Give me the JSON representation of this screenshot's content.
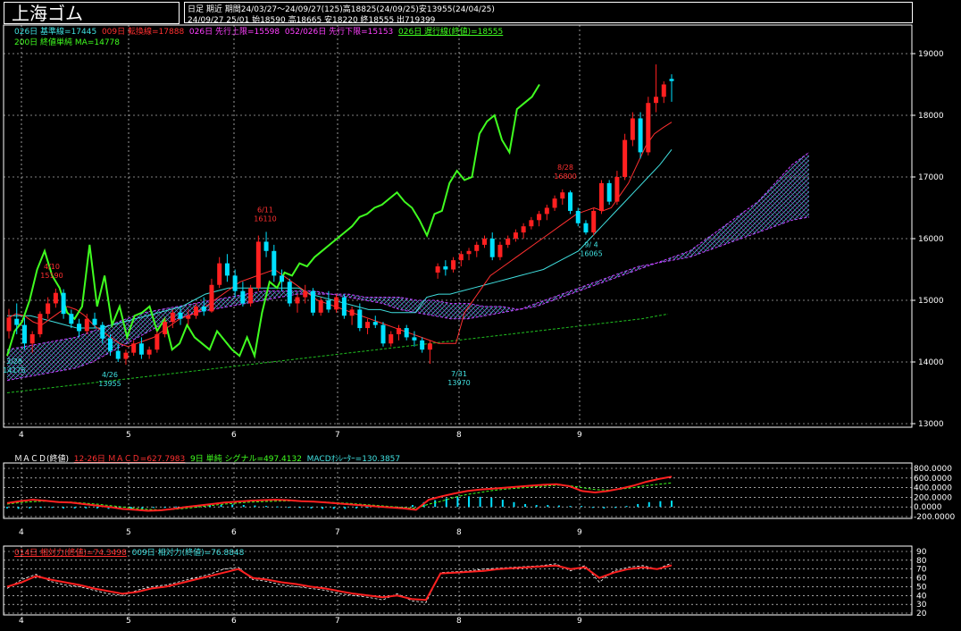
{
  "header": {
    "title": "上海ゴム",
    "period_line1": "日足  期近  期間24/03/27～24/09/27(125)高18825(24/09/25)安13955(24/04/25)",
    "period_line2": "24/09/27 25/01 始18590 高18665 安18220 終18555 出719399"
  },
  "legend": {
    "kijun": "026日 基準線=17445",
    "tenkan": "009日 転換線=17888",
    "senkou1": "026日 先行上限=15598",
    "senkou2": "052/026日 先行下限=15153",
    "chikou": "026日 遅行線(終値)=18555",
    "ma200": "200日 終値単純 MA=14778"
  },
  "macd_legend": {
    "name": "ＭＡＣＤ(終値)",
    "macd": "12-26日 ＭＡＣＤ=627.7983",
    "signal": "9日 単純 シグナル=497.4132",
    "osc": "MACDｵｼﾚｰﾀｰ=130.3857"
  },
  "rsi_legend": {
    "rsi14": "014日 相対力(終値)=74.3498",
    "rsi9": "009日 相対力(終値)=76.8848"
  },
  "colors": {
    "bg": "#000000",
    "up": "#ff2020",
    "down": "#00e0ff",
    "chikou": "#40ff20",
    "ma": "#20c020",
    "kijun": "#40e0e0",
    "tenkan": "#ff3030",
    "cloud": "#c040ff",
    "grid": "#ffffff"
  },
  "chart_data": [
    {
      "type": "candlestick",
      "ylim": [
        13000,
        19200
      ],
      "yticks": [
        "19000",
        "18000",
        "17000",
        "16000",
        "15000",
        "14000",
        "13000"
      ],
      "xtick_labels": [
        "4",
        "5",
        "6",
        "7",
        "8",
        "9"
      ],
      "annotations": [
        {
          "label": "4/10",
          "value": "15190"
        },
        {
          "label": "3/28",
          "value": "14175"
        },
        {
          "label": "4/26",
          "value": "13955"
        },
        {
          "label": "6/11",
          "value": "16110"
        },
        {
          "label": "7/31",
          "value": "13970"
        },
        {
          "label": "8/28",
          "value": "16800"
        },
        {
          "label": "9/ 4",
          "value": "16065"
        }
      ],
      "ohlc": [
        [
          14500,
          14860,
          14380,
          14720
        ],
        [
          14700,
          14950,
          14450,
          14600
        ],
        [
          14600,
          14720,
          14200,
          14300
        ],
        [
          14300,
          14500,
          14150,
          14450
        ],
        [
          14450,
          14820,
          14400,
          14780
        ],
        [
          14780,
          15050,
          14700,
          14950
        ],
        [
          14950,
          15190,
          14880,
          15120
        ],
        [
          15120,
          15180,
          14700,
          14780
        ],
        [
          14780,
          14850,
          14550,
          14620
        ],
        [
          14620,
          14700,
          14400,
          14500
        ],
        [
          14500,
          14780,
          14450,
          14700
        ],
        [
          14700,
          14800,
          14550,
          14600
        ],
        [
          14600,
          14650,
          14300,
          14380
        ],
        [
          14380,
          14450,
          14100,
          14180
        ],
        [
          14180,
          14300,
          14000,
          14050
        ],
        [
          14050,
          14200,
          13955,
          14150
        ],
        [
          14150,
          14350,
          14100,
          14300
        ],
        [
          14300,
          14400,
          14050,
          14120
        ],
        [
          14120,
          14250,
          14050,
          14200
        ],
        [
          14200,
          14500,
          14150,
          14450
        ],
        [
          14450,
          14700,
          14400,
          14650
        ],
        [
          14650,
          14850,
          14550,
          14800
        ],
        [
          14800,
          14900,
          14600,
          14700
        ],
        [
          14700,
          14850,
          14600,
          14750
        ],
        [
          14750,
          14950,
          14700,
          14900
        ],
        [
          14900,
          15050,
          14750,
          14820
        ],
        [
          14820,
          15350,
          14800,
          15250
        ],
        [
          15250,
          15700,
          15200,
          15600
        ],
        [
          15600,
          15750,
          15300,
          15400
        ],
        [
          15400,
          15500,
          15050,
          15150
        ],
        [
          15150,
          15300,
          14900,
          14950
        ],
        [
          14950,
          15250,
          14900,
          15200
        ],
        [
          15200,
          16050,
          15150,
          15950
        ],
        [
          15950,
          16110,
          15700,
          15800
        ],
        [
          15800,
          15900,
          15300,
          15400
        ],
        [
          15400,
          15500,
          15150,
          15300
        ],
        [
          15300,
          15350,
          14900,
          14950
        ],
        [
          14950,
          15100,
          14800,
          15050
        ],
        [
          15050,
          15250,
          14950,
          15150
        ],
        [
          15150,
          15200,
          14750,
          14800
        ],
        [
          14800,
          15050,
          14750,
          15000
        ],
        [
          15000,
          15150,
          14800,
          14850
        ],
        [
          14850,
          15100,
          14800,
          15050
        ],
        [
          15050,
          15100,
          14700,
          14750
        ],
        [
          14750,
          14900,
          14600,
          14850
        ],
        [
          14850,
          14950,
          14500,
          14550
        ],
        [
          14550,
          14700,
          14450,
          14650
        ],
        [
          14650,
          14750,
          14550,
          14600
        ],
        [
          14600,
          14650,
          14250,
          14300
        ],
        [
          14300,
          14500,
          14250,
          14450
        ],
        [
          14450,
          14600,
          14350,
          14550
        ],
        [
          14550,
          14600,
          14350,
          14400
        ],
        [
          14400,
          14500,
          14250,
          14350
        ],
        [
          14350,
          14400,
          14150,
          14200
        ],
        [
          14200,
          14350,
          13970,
          14300
        ],
        [
          15450,
          15600,
          15350,
          15550
        ],
        [
          15550,
          15650,
          15400,
          15500
        ],
        [
          15500,
          15700,
          15450,
          15650
        ],
        [
          15650,
          15800,
          15550,
          15750
        ],
        [
          15750,
          15850,
          15650,
          15800
        ],
        [
          15800,
          15950,
          15700,
          15900
        ],
        [
          15900,
          16050,
          15850,
          16000
        ],
        [
          16000,
          16100,
          15650,
          15700
        ],
        [
          15700,
          15950,
          15650,
          15900
        ],
        [
          15900,
          16050,
          15850,
          16000
        ],
        [
          16000,
          16150,
          15950,
          16100
        ],
        [
          16100,
          16250,
          16000,
          16200
        ],
        [
          16200,
          16350,
          16150,
          16300
        ],
        [
          16300,
          16450,
          16200,
          16400
        ],
        [
          16400,
          16550,
          16300,
          16500
        ],
        [
          16500,
          16700,
          16450,
          16650
        ],
        [
          16650,
          16800,
          16550,
          16750
        ],
        [
          16750,
          16780,
          16400,
          16450
        ],
        [
          16450,
          16500,
          16200,
          16250
        ],
        [
          16250,
          16300,
          16065,
          16100
        ],
        [
          16100,
          16500,
          16050,
          16450
        ],
        [
          16450,
          16950,
          16400,
          16900
        ],
        [
          16900,
          16950,
          16550,
          16600
        ],
        [
          16600,
          17100,
          16550,
          17000
        ],
        [
          17000,
          17700,
          16950,
          17600
        ],
        [
          17600,
          18050,
          17500,
          17950
        ],
        [
          17950,
          18050,
          17300,
          17400
        ],
        [
          17400,
          18300,
          17350,
          18200
        ],
        [
          18200,
          18825,
          18050,
          18300
        ],
        [
          18300,
          18550,
          18200,
          18500
        ],
        [
          18590,
          18665,
          18220,
          18555
        ]
      ],
      "chikou_span": [
        14100,
        14500,
        14650,
        15000,
        15500,
        15800,
        15400,
        15200,
        14800,
        14700,
        14900,
        15900,
        14900,
        15400,
        14600,
        14900,
        14400,
        14750,
        14800,
        14900,
        14500,
        14700,
        14200,
        14300,
        14600,
        14400,
        14300,
        14200,
        14500,
        14350,
        14200,
        14100,
        14400,
        14100,
        14800,
        15300,
        15200,
        15450,
        15400,
        15600,
        15550,
        15700,
        15800,
        15900,
        16000,
        16100,
        16200,
        16350,
        16400,
        16500,
        16550,
        16650,
        16750,
        16600,
        16500,
        16300,
        16050,
        16400,
        16450,
        16900,
        17100,
        16950,
        17000,
        17700,
        17900,
        18000,
        17600,
        17400,
        18100,
        18200,
        18300,
        18500
      ],
      "tenkan_sen": [
        14700,
        14780,
        14750,
        14650,
        14600,
        14700,
        14800,
        14900,
        14850,
        14750,
        14600,
        14500,
        14400,
        14300,
        14250,
        14300,
        14350,
        14400,
        14500,
        14600,
        14700,
        14750,
        14800,
        14900,
        15000,
        15100,
        15200,
        15300,
        15350,
        15400,
        15450,
        15500,
        15400,
        15300,
        15200,
        15100,
        15000,
        14950,
        14900,
        14850,
        14800,
        14750,
        14700,
        14650,
        14600,
        14550,
        14500,
        14450,
        14400,
        14350,
        14300,
        14300,
        14300,
        14800,
        15000,
        15200,
        15400,
        15500,
        15600,
        15700,
        15800,
        15900,
        16000,
        16100,
        16200,
        16300,
        16400,
        16450,
        16500,
        16450,
        16500,
        16700,
        16900,
        17200,
        17500,
        17700,
        17800,
        17888
      ],
      "kijun_sen": [
        14750,
        14750,
        14750,
        14700,
        14650,
        14600,
        14550,
        14550,
        14550,
        14600,
        14650,
        14700,
        14750,
        14800,
        14850,
        14900,
        15000,
        15100,
        15150,
        15200,
        15200,
        15200,
        15200,
        15200,
        15200,
        15200,
        15100,
        15050,
        15000,
        14950,
        14900,
        14850,
        14850,
        14800,
        14800,
        14800,
        15050,
        15100,
        15100,
        15150,
        15200,
        15250,
        15300,
        15350,
        15400,
        15450,
        15500,
        15600,
        15700,
        15800,
        16000,
        16200,
        16400,
        16600,
        16800,
        17000,
        17200,
        17445
      ],
      "cloud_upper": [
        14200,
        14250,
        14300,
        14350,
        14400,
        14500,
        14600,
        14700,
        14800,
        14850,
        14900,
        14950,
        15000,
        15050,
        15100,
        15150,
        15150,
        15150,
        15150,
        15100,
        15100,
        15050,
        15050,
        15050,
        15000,
        15000,
        14950,
        14950,
        14900,
        14900,
        14850,
        14900,
        15000,
        15100,
        15200,
        15300,
        15400,
        15500,
        15600,
        15700,
        15800,
        16000,
        16200,
        16400,
        16600,
        16900,
        17200,
        17400
      ],
      "cloud_lower": [
        13700,
        13750,
        13800,
        13850,
        13900,
        14000,
        14150,
        14300,
        14450,
        14600,
        14700,
        14800,
        14850,
        14900,
        14950,
        15000,
        15050,
        15100,
        15100,
        15100,
        15050,
        15000,
        14950,
        14850,
        14800,
        14750,
        14700,
        14700,
        14750,
        14800,
        14850,
        14950,
        15050,
        15150,
        15250,
        15350,
        15450,
        15550,
        15600,
        15650,
        15700,
        15800,
        15900,
        16000,
        16100,
        16200,
        16300,
        16350
      ],
      "ma200": [
        13500,
        13550,
        13600,
        13650,
        13700,
        13750,
        13800,
        13850,
        13900,
        13950,
        14000,
        14050,
        14100,
        14150,
        14200,
        14250,
        14300,
        14350,
        14400,
        14450,
        14500,
        14550,
        14600,
        14650,
        14700,
        14778
      ]
    },
    {
      "type": "line",
      "title": "ＭＡＣＤ(終値)",
      "ylim": [
        -200,
        800
      ],
      "yticks": [
        "800.0000",
        "600.0000",
        "400.0000",
        "200.0000",
        "0.0000",
        "-200.0000"
      ],
      "series": [
        {
          "name": "12-26日 ＭＡＣＤ",
          "values": [
            80,
            120,
            150,
            130,
            100,
            90,
            60,
            30,
            0,
            -40,
            -60,
            -80,
            -70,
            -40,
            0,
            30,
            60,
            90,
            110,
            130,
            140,
            150,
            140,
            120,
            110,
            90,
            70,
            50,
            30,
            10,
            -10,
            -30,
            -60,
            150,
            220,
            280,
            330,
            360,
            380,
            400,
            420,
            440,
            460,
            470,
            430,
            330,
            300,
            330,
            380,
            440,
            520,
            580,
            627.8
          ]
        },
        {
          "name": "9日 単純 シグナル",
          "values": [
            60,
            90,
            110,
            120,
            110,
            100,
            80,
            60,
            30,
            0,
            -30,
            -50,
            -60,
            -50,
            -30,
            0,
            30,
            60,
            80,
            100,
            110,
            120,
            125,
            120,
            110,
            100,
            85,
            70,
            50,
            30,
            10,
            -10,
            -30,
            60,
            120,
            200,
            260,
            300,
            340,
            370,
            390,
            410,
            430,
            450,
            440,
            400,
            360,
            350,
            370,
            400,
            440,
            470,
            497.4
          ]
        }
      ],
      "oscillator": [
        -30,
        -40,
        -30,
        -20,
        -20,
        -30,
        -30,
        -30,
        -30,
        -40,
        -40,
        -40,
        -30,
        -20,
        -10,
        10,
        20,
        30,
        40,
        40,
        50,
        40,
        30,
        20,
        10,
        -10,
        -20,
        -30,
        -40,
        -40,
        -40,
        -30,
        -20,
        -10,
        -10,
        0,
        40,
        100,
        140,
        180,
        210,
        220,
        210,
        190,
        150,
        100,
        60,
        40,
        40,
        30,
        20,
        20,
        -20,
        -30,
        -20,
        20,
        60,
        100,
        120,
        130.4
      ]
    },
    {
      "type": "line",
      "title": "相対力(終値)",
      "ylim": [
        20,
        90
      ],
      "yticks": [
        "90",
        "80",
        "70",
        "60",
        "50",
        "40",
        "30",
        "20"
      ],
      "series": [
        {
          "name": "014日 相対力(終値)",
          "values": [
            50,
            55,
            62,
            58,
            55,
            52,
            48,
            45,
            42,
            44,
            48,
            50,
            54,
            58,
            62,
            66,
            70,
            60,
            58,
            55,
            53,
            50,
            48,
            45,
            42,
            40,
            38,
            40,
            36,
            35,
            65,
            66,
            67,
            68,
            70,
            71,
            72,
            73,
            74,
            70,
            72,
            60,
            66,
            70,
            72,
            70,
            74.3
          ]
        },
        {
          "name": "009日 相対力(終値)",
          "values": [
            48,
            58,
            64,
            56,
            52,
            50,
            46,
            42,
            40,
            46,
            50,
            52,
            56,
            60,
            64,
            70,
            72,
            58,
            56,
            52,
            50,
            48,
            46,
            42,
            40,
            38,
            35,
            42,
            34,
            32,
            66,
            67,
            68,
            70,
            71,
            72,
            73,
            74,
            76,
            68,
            74,
            55,
            68,
            72,
            74,
            70,
            76.9
          ]
        }
      ]
    }
  ]
}
